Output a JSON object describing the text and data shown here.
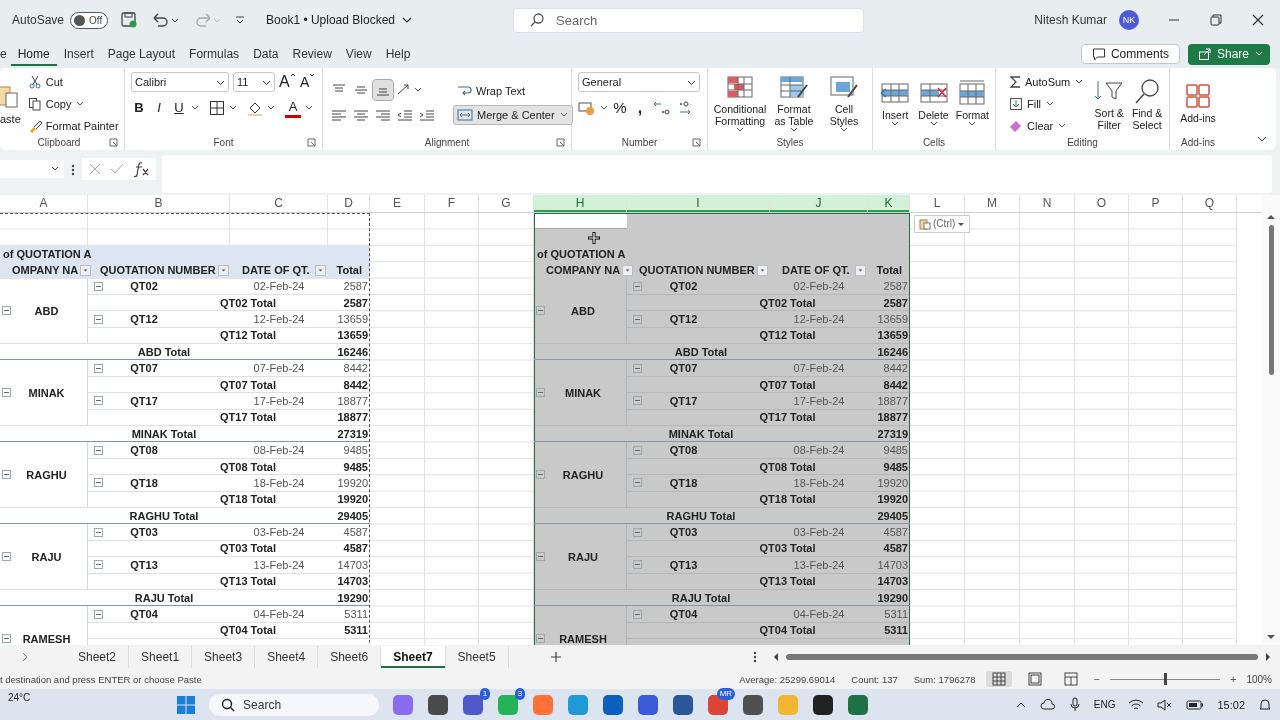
{
  "title_bar": {
    "autosave_label": "AutoSave",
    "autosave": {
      "on": false,
      "label": "Off"
    },
    "document_title": "Book1 • Upload Blocked",
    "search_placeholder": "Search",
    "user_name": "Nitesh Kumar",
    "avatar_initials": "NK"
  },
  "menu_tabs": [
    {
      "label": "e",
      "selected": false
    },
    {
      "label": "Home",
      "selected": true
    },
    {
      "label": "Insert",
      "selected": false
    },
    {
      "label": "Page Layout",
      "selected": false
    },
    {
      "label": "Formulas",
      "selected": false
    },
    {
      "label": "Data",
      "selected": false
    },
    {
      "label": "Review",
      "selected": false
    },
    {
      "label": "View",
      "selected": false
    },
    {
      "label": "Help",
      "selected": false
    }
  ],
  "header_buttons": {
    "comments": "Comments",
    "share": "Share"
  },
  "ribbon": {
    "clipboard": {
      "label": "Clipboard",
      "paste": "aste",
      "cut": "Cut",
      "copy": "Copy",
      "format_painter": "Format Painter"
    },
    "font": {
      "label": "Font",
      "font_name": "Calibri",
      "font_size": "11",
      "grow": "A",
      "shrink": "A",
      "bold": "B",
      "italic": "I",
      "underline": "U",
      "font_color": "A"
    },
    "alignment": {
      "label": "Alignment",
      "vertical": [
        {
          "kind": "top",
          "selected": false
        },
        {
          "kind": "middle",
          "selected": false
        },
        {
          "kind": "bottom",
          "selected": true
        }
      ],
      "wrap_text": "Wrap Text",
      "merge_center": {
        "label": "Merge & Center",
        "on": true
      }
    },
    "number": {
      "label": "Number",
      "format": "General",
      "percent": "%",
      "comma": ","
    },
    "styles": {
      "label": "Styles",
      "buttons": [
        {
          "kind": "conditional",
          "label": "Conditional Formatting"
        },
        {
          "kind": "table",
          "label": "Format as Table"
        },
        {
          "kind": "cell",
          "label": "Cell Styles"
        }
      ]
    },
    "cells": {
      "label": "Cells",
      "buttons": [
        {
          "kind": "insert",
          "label": "Insert"
        },
        {
          "kind": "delete",
          "label": "Delete"
        },
        {
          "kind": "format",
          "label": "Format"
        }
      ]
    },
    "editing": {
      "label": "Editing",
      "autosum": "AutoSum",
      "fill": "Fill",
      "clear": "Clear",
      "sort_filter": "Sort & Filter",
      "find_select": "Find & Select"
    },
    "addins": {
      "label": "Add-ins",
      "button": "Add-ins"
    }
  },
  "columns": [
    {
      "label": "A",
      "selected": false
    },
    {
      "label": "B",
      "selected": false
    },
    {
      "label": "C",
      "selected": false
    },
    {
      "label": "D",
      "selected": false
    },
    {
      "label": "E",
      "selected": false
    },
    {
      "label": "F",
      "selected": false
    },
    {
      "label": "G",
      "selected": false
    },
    {
      "label": "H",
      "selected": true
    },
    {
      "label": "I",
      "selected": true
    },
    {
      "label": "J",
      "selected": true
    },
    {
      "label": "K",
      "selected": true
    },
    {
      "label": "L",
      "selected": false
    },
    {
      "label": "M",
      "selected": false
    },
    {
      "label": "N",
      "selected": false
    },
    {
      "label": "O",
      "selected": false
    },
    {
      "label": "P",
      "selected": false
    },
    {
      "label": "Q",
      "selected": false
    }
  ],
  "paste_options": "(Ctrl)",
  "pivots": [
    {
      "selected": false,
      "copied": true,
      "title": "of QUOTATION A",
      "headers": [
        {
          "label": "OMPANY NA",
          "filter": true
        },
        {
          "label": "QUOTATION NUMBER",
          "filter": true
        },
        {
          "label": "DATE OF QT.",
          "filter": true
        },
        {
          "label": "Total",
          "filter": false
        }
      ],
      "groups": [
        {
          "company": "ABD",
          "expanded": true,
          "items": [
            {
              "quote": "QT02",
              "expanded": true,
              "date": "02-Feb-24",
              "amount": "2587",
              "total_label": "QT02 Total",
              "total": "2587"
            },
            {
              "quote": "QT12",
              "expanded": true,
              "date": "12-Feb-24",
              "amount": "13659",
              "total_label": "QT12 Total",
              "total": "13659"
            }
          ],
          "total_label": "ABD Total",
          "total": "16246"
        },
        {
          "company": "MINAK",
          "expanded": true,
          "items": [
            {
              "quote": "QT07",
              "expanded": true,
              "date": "07-Feb-24",
              "amount": "8442",
              "total_label": "QT07 Total",
              "total": "8442"
            },
            {
              "quote": "QT17",
              "expanded": true,
              "date": "17-Feb-24",
              "amount": "18877",
              "total_label": "QT17 Total",
              "total": "18877"
            }
          ],
          "total_label": "MINAK Total",
          "total": "27319"
        },
        {
          "company": "RAGHU",
          "expanded": true,
          "items": [
            {
              "quote": "QT08",
              "expanded": true,
              "date": "08-Feb-24",
              "amount": "9485",
              "total_label": "QT08 Total",
              "total": "9485"
            },
            {
              "quote": "QT18",
              "expanded": true,
              "date": "18-Feb-24",
              "amount": "19920",
              "total_label": "QT18 Total",
              "total": "19920"
            }
          ],
          "total_label": "RAGHU Total",
          "total": "29405"
        },
        {
          "company": "RAJU",
          "expanded": true,
          "items": [
            {
              "quote": "QT03",
              "expanded": true,
              "date": "03-Feb-24",
              "amount": "4587",
              "total_label": "QT03 Total",
              "total": "4587"
            },
            {
              "quote": "QT13",
              "expanded": true,
              "date": "13-Feb-24",
              "amount": "14703",
              "total_label": "QT13 Total",
              "total": "14703"
            }
          ],
          "total_label": "RAJU Total",
          "total": "19290"
        },
        {
          "company": "RAMESH",
          "expanded": true,
          "items": [
            {
              "quote": "QT04",
              "expanded": true,
              "date": "04-Feb-24",
              "amount": "5311",
              "total_label": "QT04 Total",
              "total": "5311"
            }
          ]
        }
      ]
    },
    {
      "selected": true,
      "copied": false,
      "title": "of QUOTATION A",
      "headers": [
        {
          "label": "COMPANY NA",
          "filter": true
        },
        {
          "label": "QUOTATION NUMBER",
          "filter": true
        },
        {
          "label": "DATE OF QT.",
          "filter": true
        },
        {
          "label": "Total",
          "filter": false
        }
      ],
      "groups": [
        {
          "company": "ABD",
          "expanded": true,
          "items": [
            {
              "quote": "QT02",
              "expanded": true,
              "date": "02-Feb-24",
              "amount": "2587",
              "total_label": "QT02 Total",
              "total": "2587"
            },
            {
              "quote": "QT12",
              "expanded": true,
              "date": "12-Feb-24",
              "amount": "13659",
              "total_label": "QT12 Total",
              "total": "13659"
            }
          ],
          "total_label": "ABD Total",
          "total": "16246"
        },
        {
          "company": "MINAK",
          "expanded": true,
          "items": [
            {
              "quote": "QT07",
              "expanded": true,
              "date": "07-Feb-24",
              "amount": "8442",
              "total_label": "QT07 Total",
              "total": "8442"
            },
            {
              "quote": "QT17",
              "expanded": true,
              "date": "17-Feb-24",
              "amount": "18877",
              "total_label": "QT17 Total",
              "total": "18877"
            }
          ],
          "total_label": "MINAK Total",
          "total": "27319"
        },
        {
          "company": "RAGHU",
          "expanded": true,
          "items": [
            {
              "quote": "QT08",
              "expanded": true,
              "date": "08-Feb-24",
              "amount": "9485",
              "total_label": "QT08 Total",
              "total": "9485"
            },
            {
              "quote": "QT18",
              "expanded": true,
              "date": "18-Feb-24",
              "amount": "19920",
              "total_label": "QT18 Total",
              "total": "19920"
            }
          ],
          "total_label": "RAGHU Total",
          "total": "29405"
        },
        {
          "company": "RAJU",
          "expanded": true,
          "items": [
            {
              "quote": "QT03",
              "expanded": true,
              "date": "03-Feb-24",
              "amount": "4587",
              "total_label": "QT03 Total",
              "total": "4587"
            },
            {
              "quote": "QT13",
              "expanded": true,
              "date": "13-Feb-24",
              "amount": "14703",
              "total_label": "QT13 Total",
              "total": "14703"
            }
          ],
          "total_label": "RAJU Total",
          "total": "19290"
        },
        {
          "company": "RAMESH",
          "expanded": true,
          "items": [
            {
              "quote": "QT04",
              "expanded": true,
              "date": "04-Feb-24",
              "amount": "5311",
              "total_label": "QT04 Total",
              "total": "5311"
            }
          ]
        }
      ]
    }
  ],
  "sheet_tabs": [
    {
      "label": "Sheet2",
      "selected": false
    },
    {
      "label": "Sheet1",
      "selected": false
    },
    {
      "label": "Sheet3",
      "selected": false
    },
    {
      "label": "Sheet4",
      "selected": false
    },
    {
      "label": "Sheet6",
      "selected": false
    },
    {
      "label": "Sheet7",
      "selected": true
    },
    {
      "label": "Sheet5",
      "selected": false
    }
  ],
  "status_bar": {
    "message": "t destination and press ENTER or choose Paste",
    "average": "Average: 25299.69014",
    "count": "Count: 137",
    "sum": "Sum: 1796278",
    "views": [
      {
        "kind": "normal",
        "selected": true
      },
      {
        "kind": "page_layout",
        "selected": false
      },
      {
        "kind": "page_break",
        "selected": false
      }
    ],
    "zoom": {
      "minus": "−",
      "plus": "+",
      "level": 0.5,
      "label": "100%"
    }
  },
  "taskbar": {
    "temperature": "24°C",
    "search_placeholder": "Search",
    "apps": [
      {
        "color": "#8a6cf0"
      },
      {
        "color": "#4a4a4a"
      },
      {
        "color": "#5059c9",
        "badge": "1"
      },
      {
        "color": "#25b35a",
        "badge": "3"
      },
      {
        "color": "#ff7139"
      },
      {
        "color": "#1f9ad6"
      },
      {
        "color": "#0a5fbf"
      },
      {
        "color": "#3b5bdb"
      },
      {
        "color": "#2b579a"
      },
      {
        "color": "#db4437",
        "badge": "MR"
      },
      {
        "color": "#505050"
      },
      {
        "color": "#f2b632"
      },
      {
        "color": "#222222"
      },
      {
        "color": "#1e7145"
      }
    ],
    "language": "ENG",
    "time": "15:02"
  }
}
